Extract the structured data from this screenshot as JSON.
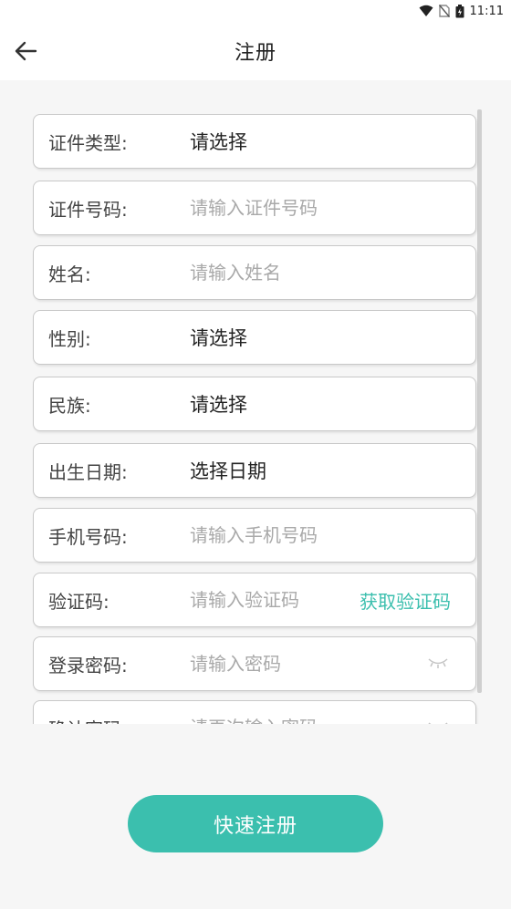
{
  "status_bar": {
    "time": "11:11"
  },
  "appbar": {
    "title": "注册"
  },
  "form": {
    "id_type": {
      "label": "证件类型:",
      "value": "请选择"
    },
    "id_number": {
      "label": "证件号码:",
      "placeholder": "请输入证件号码"
    },
    "name": {
      "label": "姓名:",
      "placeholder": "请输入姓名"
    },
    "gender": {
      "label": "性别:",
      "value": "请选择"
    },
    "ethnicity": {
      "label": "民族:",
      "value": "请选择"
    },
    "birth_date": {
      "label": "出生日期:",
      "value": "选择日期"
    },
    "phone": {
      "label": "手机号码:",
      "placeholder": "请输入手机号码"
    },
    "code": {
      "label": "验证码:",
      "placeholder": "请输入验证码",
      "get_code": "获取验证码"
    },
    "password": {
      "label": "登录密码:",
      "placeholder": "请输入密码"
    },
    "confirm_password": {
      "label": "确认密码:",
      "placeholder": "请再次输入密码"
    }
  },
  "submit": {
    "label": "快速注册"
  },
  "colors": {
    "accent": "#3bbfae",
    "placeholder": "#a9a9a9",
    "border": "#c8c8c8"
  },
  "icons": [
    "wifi-icon",
    "no-sim-icon",
    "battery-icon",
    "back-arrow-icon",
    "eye-closed-icon"
  ]
}
